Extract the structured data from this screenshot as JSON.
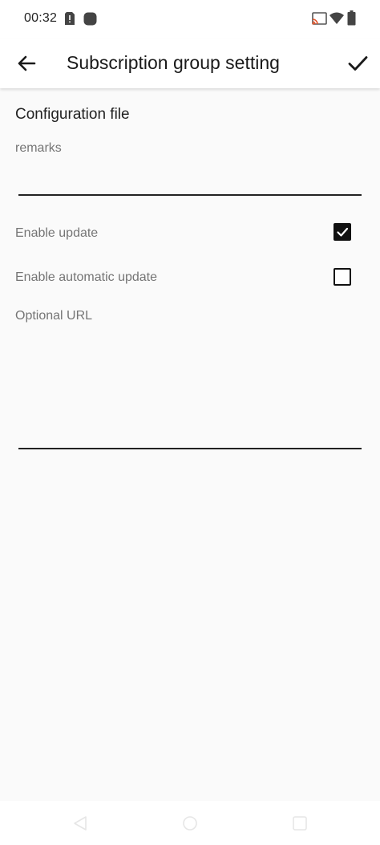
{
  "status_bar": {
    "time": "00:32",
    "left_icons": [
      "sim-alert-icon",
      "notification-icon"
    ],
    "right_icons": [
      "cast-icon",
      "wifi-icon",
      "battery-icon"
    ]
  },
  "toolbar": {
    "title": "Subscription group setting",
    "back_icon": "arrow-back-icon",
    "confirm_icon": "check-icon"
  },
  "form": {
    "section_title": "Configuration file",
    "remarks": {
      "label": "remarks",
      "value": ""
    },
    "enable_update": {
      "label": "Enable update",
      "checked": true
    },
    "enable_auto_update": {
      "label": "Enable automatic update",
      "checked": false
    },
    "optional_url": {
      "label": "Optional URL",
      "value": ""
    }
  },
  "nav_bar": {
    "buttons": [
      "back-triangle-icon",
      "home-circle-icon",
      "recents-square-icon"
    ]
  },
  "colors": {
    "background": "#fafafa",
    "toolbar": "#ffffff",
    "label_gray": "#757575",
    "text_dark": "#212121",
    "accent": "#111111"
  }
}
